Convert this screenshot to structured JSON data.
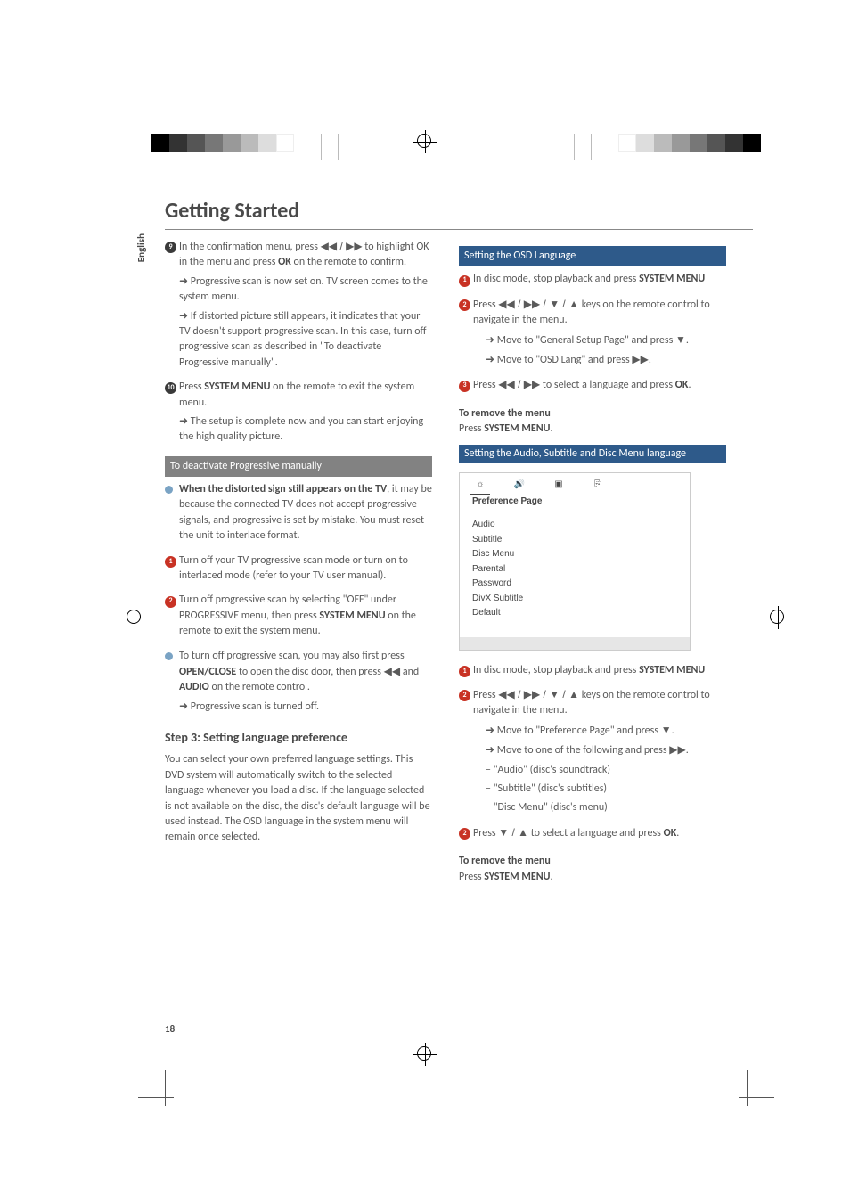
{
  "pageNumber": "18",
  "langTab": "English",
  "title": "Getting Started",
  "colorbar": [
    "#00aeef",
    "#ec008c",
    "#fff200",
    "#000000",
    "#00aeef",
    "#ec008c",
    "#fff200",
    "#000000"
  ],
  "greybar": [
    "#000000",
    "#333333",
    "#555555",
    "#777777",
    "#999999",
    "#bbbbbb",
    "#dddddd",
    "#ffffff"
  ],
  "left": {
    "s9": {
      "num": "9",
      "line1a": "In the confirmation menu, press ",
      "line1b": " to highlight OK in the menu and press ",
      "ok": "OK",
      "line1c": " on the remote to confirm.",
      "arrow1": "Progressive scan is now set on. TV screen comes to the system menu.",
      "arrow2": "If distorted picture still appears, it indicates that your TV doesn't support progressive scan. In this case, turn off progressive scan as described in \"To deactivate Progressive manually\"."
    },
    "s10": {
      "num": "10",
      "line1a": "Press ",
      "sysmenu": "SYSTEM MENU",
      "line1b": " on the remote to exit the system menu.",
      "arrow1": "The setup is complete now and you can start enjoying the high quality picture."
    },
    "deactHeading": "To deactivate Progressive manually",
    "bullet1": {
      "bold": "When the distorted sign still appears on the TV",
      "rest": ", it may be because the connected TV does not accept progressive signals, and progressive is set by mistake. You must reset the unit to interlace format."
    },
    "d1": {
      "num": "1",
      "text": "Turn off your TV progressive scan mode or turn on to interlaced mode (refer to your TV user manual)."
    },
    "d2": {
      "num": "2",
      "a": "Turn off progressive scan by selecting \"OFF\" under PROGRESSIVE menu, then press ",
      "sysmenu": "SYSTEM MENU",
      "b": " on the remote to exit the system menu."
    },
    "bullet2": {
      "a": "To turn off progressive scan, you may also first press ",
      "openclose": "OPEN/CLOSE",
      "b": " to open the disc door, then press ",
      "c": " and ",
      "audio": "AUDIO",
      "d": " on the remote control."
    },
    "arrowOff": "Progressive scan is turned off.",
    "step3Heading": "Step 3: Setting language preference",
    "step3Para": "You can select your own preferred language settings. This DVD system will automatically switch to the selected language whenever you load a disc. If the language selected is not available on the disc, the disc's default language will be used instead. The OSD language in the system menu will remain once selected."
  },
  "right": {
    "osdHeading": "Setting the OSD Language",
    "r1": {
      "num": "1",
      "a": "In disc mode,  stop playback and press ",
      "sysmenu": "SYSTEM MENU"
    },
    "r2": {
      "num": "2",
      "a": "Press ",
      "b": " keys on the remote control to navigate in the menu.",
      "arrow1a": "Move to \"General Setup Page\" and press ",
      "arrow2a": "Move to \"OSD Lang\" and press "
    },
    "r3": {
      "num": "3",
      "a": "Press ",
      "b": " to select a language and press ",
      "ok": "OK",
      "c": "."
    },
    "removeHead": "To remove the menu",
    "removeBodyA": "Press ",
    "removeBodyB": "SYSTEM MENU",
    "removeBodyC": ".",
    "audioHeading": "Setting the Audio,  Subtitle and Disc Menu language",
    "osd": {
      "title": "Preference Page",
      "items": [
        "Audio",
        "Subtitle",
        "Disc Menu",
        "Parental",
        "Password",
        "DivX Subtitle",
        "Default"
      ]
    },
    "p1": {
      "num": "1",
      "a": "In disc mode,  stop playback and press ",
      "sysmenu": "SYSTEM MENU"
    },
    "p2": {
      "num": "2",
      "a": "Press ",
      "b": " keys on the remote control to navigate in the menu.",
      "arrow1a": "Move to \"Preference Page\" and press ",
      "arrow2a": "Move to one of the following and press ",
      "opt1": "\"Audio\" (disc's soundtrack)",
      "opt2": "\"Subtitle\" (disc's subtitles)",
      "opt3": "\"Disc Menu\" (disc's menu)"
    },
    "p3": {
      "num": "2",
      "a": "Press ",
      "b": " to select a language and press ",
      "ok": "OK",
      "c": "."
    }
  },
  "glyphs": {
    "rewff": "◀◀ / ▶▶",
    "rew": "◀◀",
    "ff": "▶▶",
    "navAll": "◀◀ / ▶▶ / ▼ / ▲",
    "down": "▼",
    "updown": "▼ / ▲",
    "dot": "."
  }
}
